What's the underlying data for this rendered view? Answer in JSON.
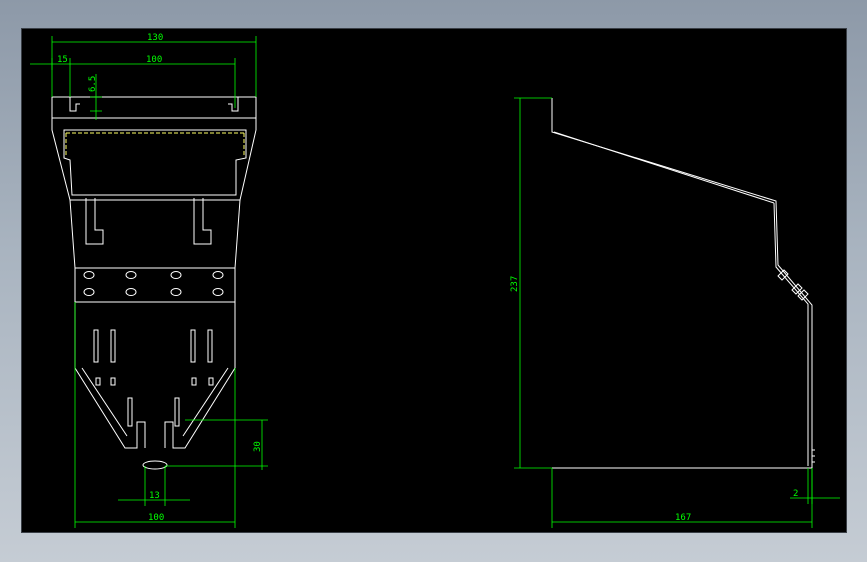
{
  "colors": {
    "viewport_bg": "#000000",
    "outline": "#ffffff",
    "dimension": "#00ff00",
    "hidden_edge": "#ffff66",
    "frame_bg": "#a9b4c0"
  },
  "dimensions": {
    "front_width_top": "130",
    "front_offset_left": "15",
    "front_inner_width": "100",
    "front_slot_depth": "6.5",
    "front_width_bottom": "100",
    "front_bottom_gap": "13",
    "front_tab_height": "30",
    "side_height": "237",
    "side_depth": "167",
    "side_thickness": "2"
  }
}
